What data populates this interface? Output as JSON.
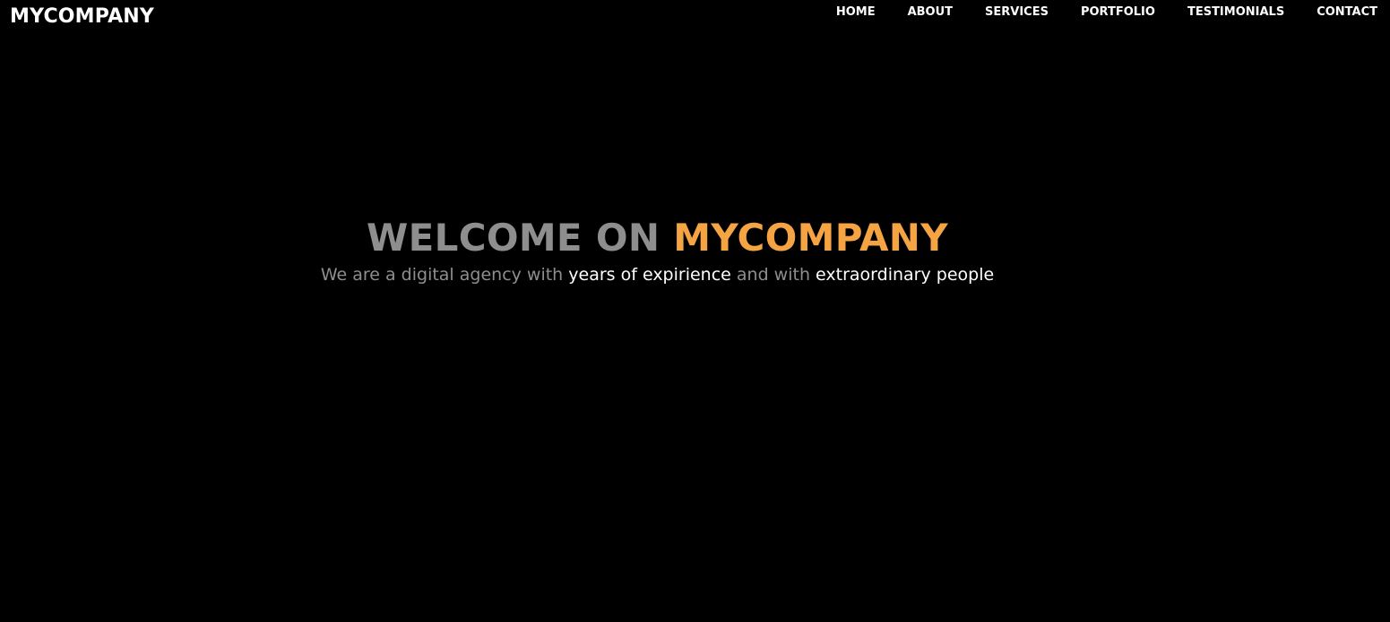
{
  "colors": {
    "background": "#000000",
    "text_white": "#ffffff",
    "text_gray": "#8e8e8e",
    "accent_orange": "#f5a443"
  },
  "header": {
    "brand": "MYCOMPANY",
    "nav": [
      {
        "label": "HOME"
      },
      {
        "label": "ABOUT"
      },
      {
        "label": "SERVICES"
      },
      {
        "label": "PORTFOLIO"
      },
      {
        "label": "TESTIMONIALS"
      },
      {
        "label": "CONTACT"
      }
    ]
  },
  "hero": {
    "title_prefix": "WELCOME ON ",
    "title_highlight": "MYCOMPANY",
    "subtitle_part1": "We are a digital agency with ",
    "subtitle_highlight1": "years of expirience",
    "subtitle_part2": " and with ",
    "subtitle_highlight2": "extraordinary people"
  }
}
